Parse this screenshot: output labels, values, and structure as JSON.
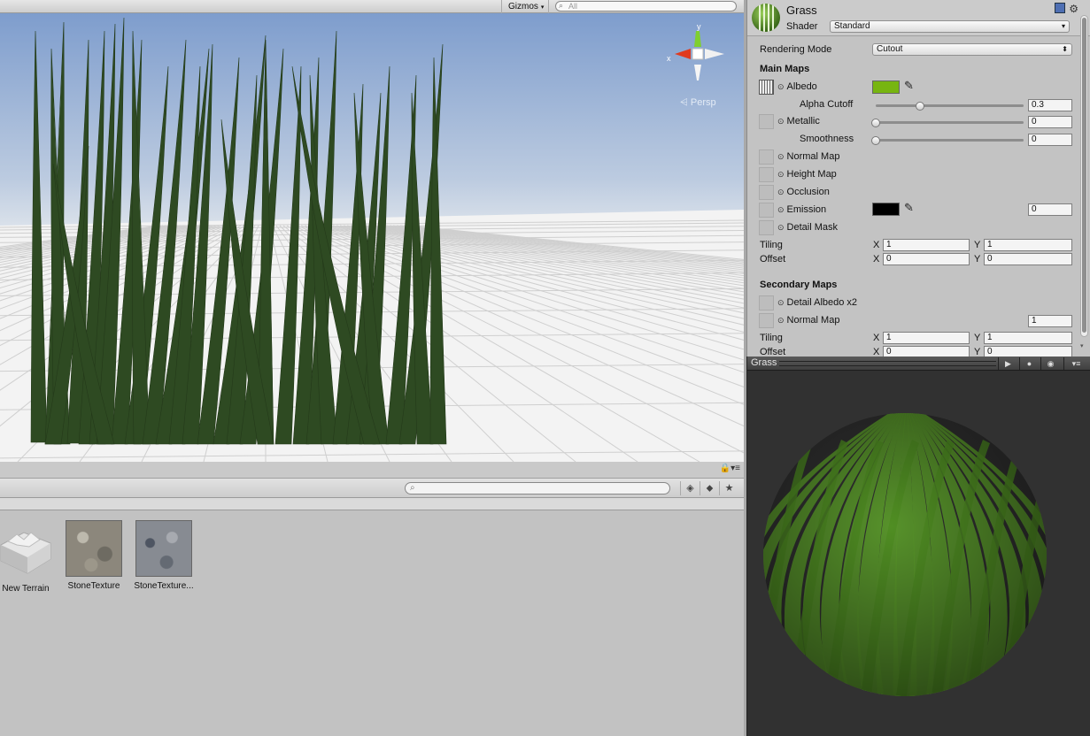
{
  "scene": {
    "toolbar": {
      "gizmos_label": "Gizmos",
      "search_placeholder": "All"
    },
    "orientation": {
      "y_label": "y",
      "x_label": "x",
      "projection_label": "Persp"
    }
  },
  "project": {
    "toolbar": {
      "search_placeholder": ""
    },
    "assets": [
      {
        "name": "New Terrain",
        "icon": "terrain-icon"
      },
      {
        "name": "StoneTexture",
        "icon": "texture-thumbnail"
      },
      {
        "name": "StoneTexture...",
        "icon": "texture-thumbnail"
      }
    ]
  },
  "inspector": {
    "material_name": "Grass",
    "shader_label": "Shader",
    "shader_value": "Standard",
    "rendering_mode_label": "Rendering Mode",
    "rendering_mode_value": "Cutout",
    "main_maps_label": "Main Maps",
    "albedo_label": "Albedo",
    "albedo_color": "#77b510",
    "alpha_cutoff_label": "Alpha Cutoff",
    "alpha_cutoff_value": "0.3",
    "alpha_cutoff_fraction": 0.3,
    "metallic_label": "Metallic",
    "metallic_value": "0",
    "smoothness_label": "Smoothness",
    "smoothness_value": "0",
    "normal_map_label": "Normal Map",
    "height_map_label": "Height Map",
    "occlusion_label": "Occlusion",
    "emission_label": "Emission",
    "emission_color": "#000000",
    "emission_value": "0",
    "detail_mask_label": "Detail Mask",
    "tiling_label": "Tiling",
    "offset_label": "Offset",
    "x_label": "X",
    "y_label": "Y",
    "main_tiling_x": "1",
    "main_tiling_y": "1",
    "main_offset_x": "0",
    "main_offset_y": "0",
    "secondary_maps_label": "Secondary Maps",
    "detail_albedo_label": "Detail Albedo x2",
    "secondary_normal_label": "Normal Map",
    "secondary_normal_value": "1",
    "secondary_tiling_x": "1",
    "secondary_tiling_y": "1",
    "secondary_offset_x": "0",
    "secondary_offset_y": "0"
  },
  "preview": {
    "title": "Grass"
  },
  "colors": {
    "grass_blade": "#2e4a22",
    "sphere_blade": "#5a9a2a",
    "sky_top": "#7f9fcf",
    "ground": "#f4f4f4"
  }
}
